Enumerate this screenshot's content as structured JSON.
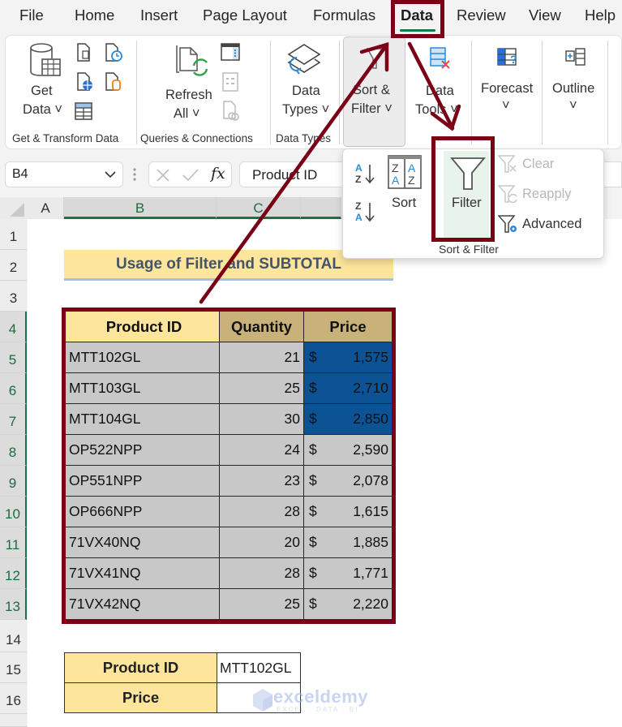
{
  "menu": {
    "tabs": [
      {
        "label": "File"
      },
      {
        "label": "Home"
      },
      {
        "label": "Insert"
      },
      {
        "label": "Page Layout"
      },
      {
        "label": "Formulas"
      },
      {
        "label": "Data",
        "active": true
      },
      {
        "label": "Review"
      },
      {
        "label": "View"
      },
      {
        "label": "Help"
      }
    ]
  },
  "ribbon": {
    "groups": [
      {
        "label": "Get & Transform Data",
        "buttons": [
          {
            "line1": "Get",
            "line2": "Data ˅",
            "icon": "database-table-icon"
          }
        ],
        "small_icons": [
          "from-text-csv-icon",
          "recent-sources-icon",
          "from-web-icon",
          "existing-connections-icon",
          "from-table-range-icon"
        ]
      },
      {
        "label": "Queries & Connections",
        "buttons": [
          {
            "line1": "Refresh",
            "line2": "All ˅",
            "icon": "refresh-all-icon"
          }
        ],
        "small_icons": [
          "queries-connections-icon",
          "properties-icon",
          "edit-links-icon"
        ]
      },
      {
        "label": "Data Types",
        "buttons": [
          {
            "line1": "Data",
            "line2": "Types ˅",
            "icon": "data-types-icon"
          }
        ]
      },
      {
        "label": "Sort & Filter",
        "buttons": [
          {
            "line1": "Sort &",
            "line2": "Filter ˅",
            "icon": "sort-filter-icon"
          }
        ]
      },
      {
        "label": "Data Tools",
        "buttons": [
          {
            "line1": "Data",
            "line2": "Tools ˅",
            "icon": "data-tools-icon"
          }
        ]
      },
      {
        "label": "Forecast",
        "buttons": [
          {
            "line1": "Forecast",
            "line2": "˅",
            "icon": "forecast-icon"
          }
        ]
      },
      {
        "label": "Outline",
        "buttons": [
          {
            "line1": "Outline",
            "line2": "˅",
            "icon": "outline-icon"
          }
        ]
      }
    ]
  },
  "sort_filter_dropdown": {
    "sort_label": "Sort",
    "filter_label": "Filter",
    "clear_label": "Clear",
    "reapply_label": "Reapply",
    "advanced_label": "Advanced",
    "group_label": "Sort & Filter"
  },
  "formula_bar": {
    "name_box": "B4",
    "formula": "Product ID",
    "fx_label": "fx"
  },
  "sheet": {
    "columns": [
      "A",
      "B",
      "C"
    ],
    "rows": [
      "1",
      "2",
      "3",
      "4",
      "5",
      "6",
      "7",
      "8",
      "9",
      "10",
      "11",
      "12",
      "13",
      "14",
      "15",
      "16"
    ],
    "title": "Usage of Filter and SUBTOTAL",
    "table": {
      "headers": [
        "Product ID",
        "Quantity",
        "Price"
      ],
      "currency_symbol": "$",
      "rows": [
        {
          "id": "MTT102GL",
          "qty": "21",
          "price": "1,575",
          "highlight": true
        },
        {
          "id": "MTT103GL",
          "qty": "25",
          "price": "2,710",
          "highlight": true
        },
        {
          "id": "MTT104GL",
          "qty": "30",
          "price": "2,850",
          "highlight": true
        },
        {
          "id": "OP522NPP",
          "qty": "24",
          "price": "2,590"
        },
        {
          "id": "OP551NPP",
          "qty": "23",
          "price": "2,078"
        },
        {
          "id": "OP666NPP",
          "qty": "28",
          "price": "1,615"
        },
        {
          "id": "71VX40NQ",
          "qty": "20",
          "price": "1,885"
        },
        {
          "id": "71VX41NQ",
          "qty": "28",
          "price": "1,771"
        },
        {
          "id": "71VX42NQ",
          "qty": "25",
          "price": "2,220"
        }
      ]
    },
    "lookup": {
      "product_id_label": "Product ID",
      "product_id_value": "MTT102GL",
      "price_label": "Price",
      "price_value": ""
    }
  },
  "watermark": {
    "name": "exceldemy",
    "tagline": "EXCEL · DATA · BI"
  },
  "colors": {
    "accent_green": "#107c41",
    "annotation_red": "#7b0016",
    "header_yellow": "#fde59b",
    "header_tan": "#c9b27a",
    "selection_blue": "#0b5394",
    "filled_gray": "#c8c8c8"
  }
}
